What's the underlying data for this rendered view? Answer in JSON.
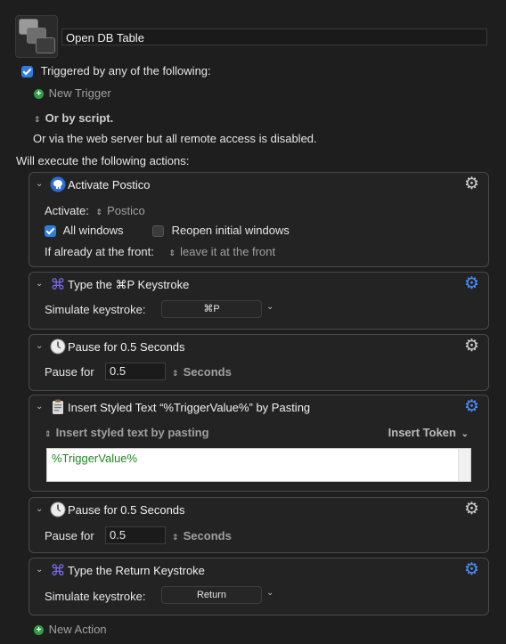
{
  "macro": {
    "name": "Open DB Table"
  },
  "triggers": {
    "enabled_label": "Triggered by any of the following:",
    "new_trigger": "New Trigger",
    "or_by_script": "Or by script.",
    "web_server_note": "Or via the web server but all remote access is disabled."
  },
  "actions_header": "Will execute the following actions:",
  "actions": [
    {
      "title": "Activate Postico",
      "icon": "postico-elephant-icon",
      "activate_label": "Activate:",
      "activate_value": "Postico",
      "all_windows_label": "All windows",
      "all_windows_checked": true,
      "reopen_label": "Reopen initial windows",
      "reopen_checked": false,
      "front_label": "If already at the front:",
      "front_value": "leave it at the front"
    },
    {
      "title": "Type the ⌘P Keystroke",
      "icon": "command-key-icon",
      "simulate_label": "Simulate keystroke:",
      "keystroke": "⌘P"
    },
    {
      "title": "Pause for 0.5 Seconds",
      "icon": "clock-icon",
      "pause_label": "Pause for",
      "pause_value": "0.5",
      "unit": "Seconds"
    },
    {
      "title": "Insert Styled Text “%TriggerValue%” by Pasting",
      "icon": "clipboard-icon",
      "mode": "Insert styled text by pasting",
      "insert_token": "Insert Token",
      "text": "%TriggerValue%"
    },
    {
      "title": "Pause for 0.5 Seconds",
      "icon": "clock-icon",
      "pause_label": "Pause for",
      "pause_value": "0.5",
      "unit": "Seconds"
    },
    {
      "title": "Type the Return Keystroke",
      "icon": "command-key-icon",
      "simulate_label": "Simulate keystroke:",
      "keystroke": "Return"
    }
  ],
  "new_action": "New Action",
  "colors": {
    "accent": "#2f7de1",
    "background": "#1e1e1e",
    "add_green": "#2ea043",
    "gear_active": "#4a90ff"
  }
}
